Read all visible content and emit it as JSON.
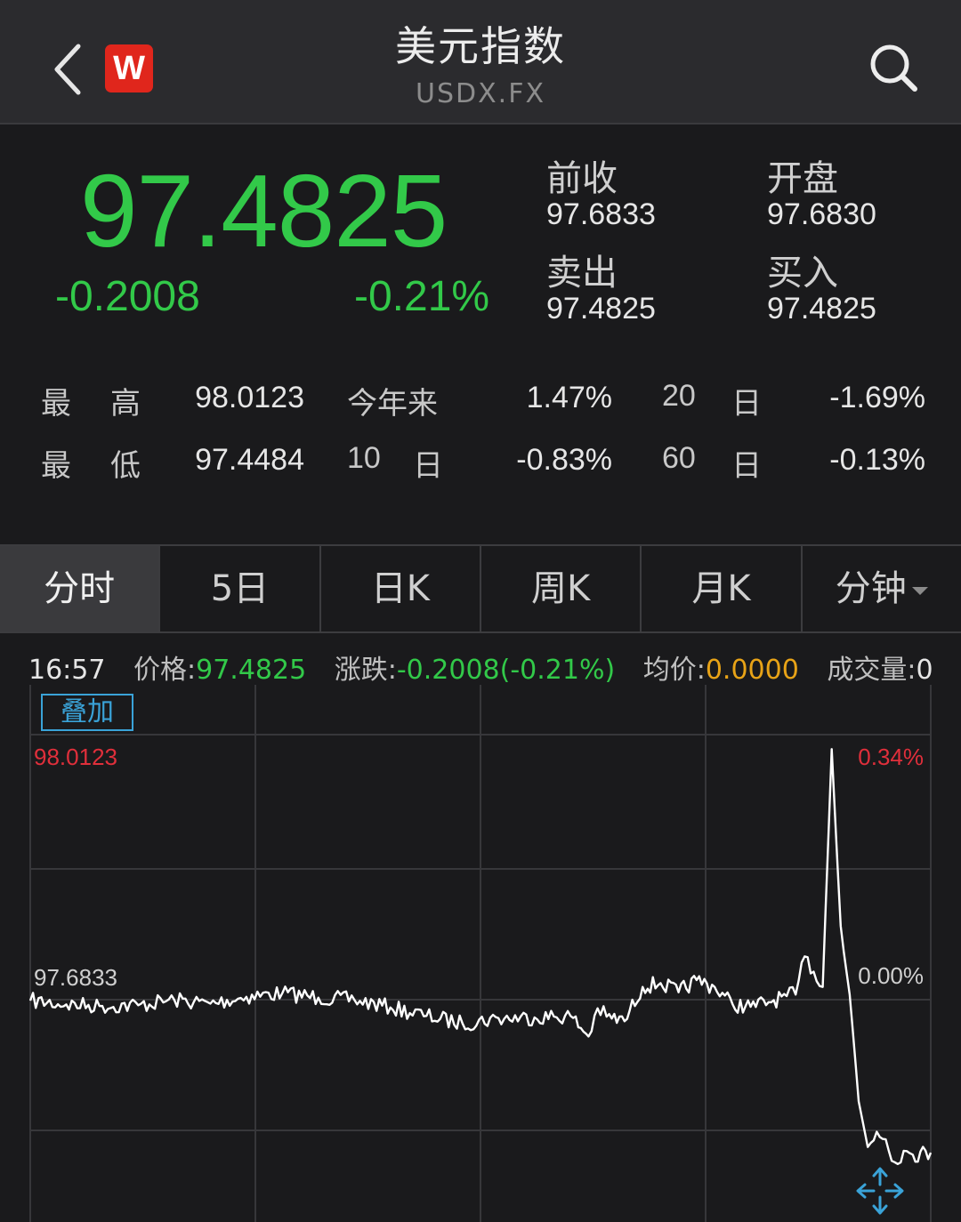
{
  "header": {
    "title": "美元指数",
    "code": "USDX.FX",
    "logo_letter": "W"
  },
  "quote": {
    "price": "97.4825",
    "change": "-0.2008",
    "change_pct": "-0.21%",
    "prev_close_label": "前收",
    "prev_close": "97.6833",
    "open_label": "开盘",
    "open": "97.6830",
    "sell_label": "卖出",
    "sell": "97.4825",
    "buy_label": "买入",
    "buy": "97.4825"
  },
  "stats": {
    "high_label_a": "最",
    "high_label_b": "高",
    "high": "98.0123",
    "low_label_a": "最",
    "low_label_b": "低",
    "low": "97.4484",
    "ytd_label": "今年来",
    "ytd": "1.47%",
    "d10_num": "10",
    "d10_unit": "日",
    "d10": "-0.83%",
    "d20_num": "20",
    "d20_unit": "日",
    "d20": "-1.69%",
    "d60_num": "60",
    "d60_unit": "日",
    "d60": "-0.13%"
  },
  "tabs": [
    "分时",
    "5日",
    "日K",
    "周K",
    "月K",
    "分钟"
  ],
  "active_tab": 0,
  "info_bar": {
    "time": "16:57",
    "price_label": "价格:",
    "price": "97.4825",
    "change_label": "涨跌:",
    "change": "-0.2008(-0.21%)",
    "avg_label": "均价:",
    "avg": "0.0000",
    "volume_label": "成交量:",
    "volume": "0"
  },
  "overlay_label": "叠加",
  "chart_labels": {
    "high_price": "98.0123",
    "high_pct": "0.34%",
    "base_price": "97.6833",
    "base_pct": "0.00%"
  },
  "colors": {
    "down": "#32c949",
    "up": "#e02f3b",
    "neutral": "#cfcfcf",
    "accent": "#3aa3d8",
    "avg": "#e8a317"
  },
  "chart_data": {
    "type": "line",
    "title": "",
    "xlabel": "",
    "ylabel": "",
    "ylim": [
      97.4484,
      98.0123
    ],
    "reference": 97.6833,
    "x": [
      0,
      4,
      8,
      12,
      16,
      20,
      24,
      28,
      32,
      36,
      40,
      44,
      48,
      52,
      56,
      60,
      62,
      63,
      64,
      66,
      68,
      70,
      72,
      74,
      76,
      78,
      80,
      82,
      84,
      85,
      86,
      87,
      88,
      89,
      90,
      91,
      92,
      93,
      94,
      95,
      96,
      97,
      98,
      100
    ],
    "values": [
      97.682,
      97.677,
      97.675,
      97.676,
      97.683,
      97.678,
      97.687,
      97.692,
      97.686,
      97.683,
      97.673,
      97.662,
      97.652,
      97.659,
      97.66,
      97.662,
      97.635,
      97.672,
      97.661,
      97.655,
      97.7,
      97.705,
      97.693,
      97.709,
      97.7,
      97.677,
      97.674,
      97.68,
      97.688,
      97.69,
      97.74,
      97.72,
      97.7,
      98.012,
      97.78,
      97.69,
      97.55,
      97.49,
      97.51,
      97.5,
      97.47,
      97.485,
      97.48,
      97.4825
    ]
  }
}
